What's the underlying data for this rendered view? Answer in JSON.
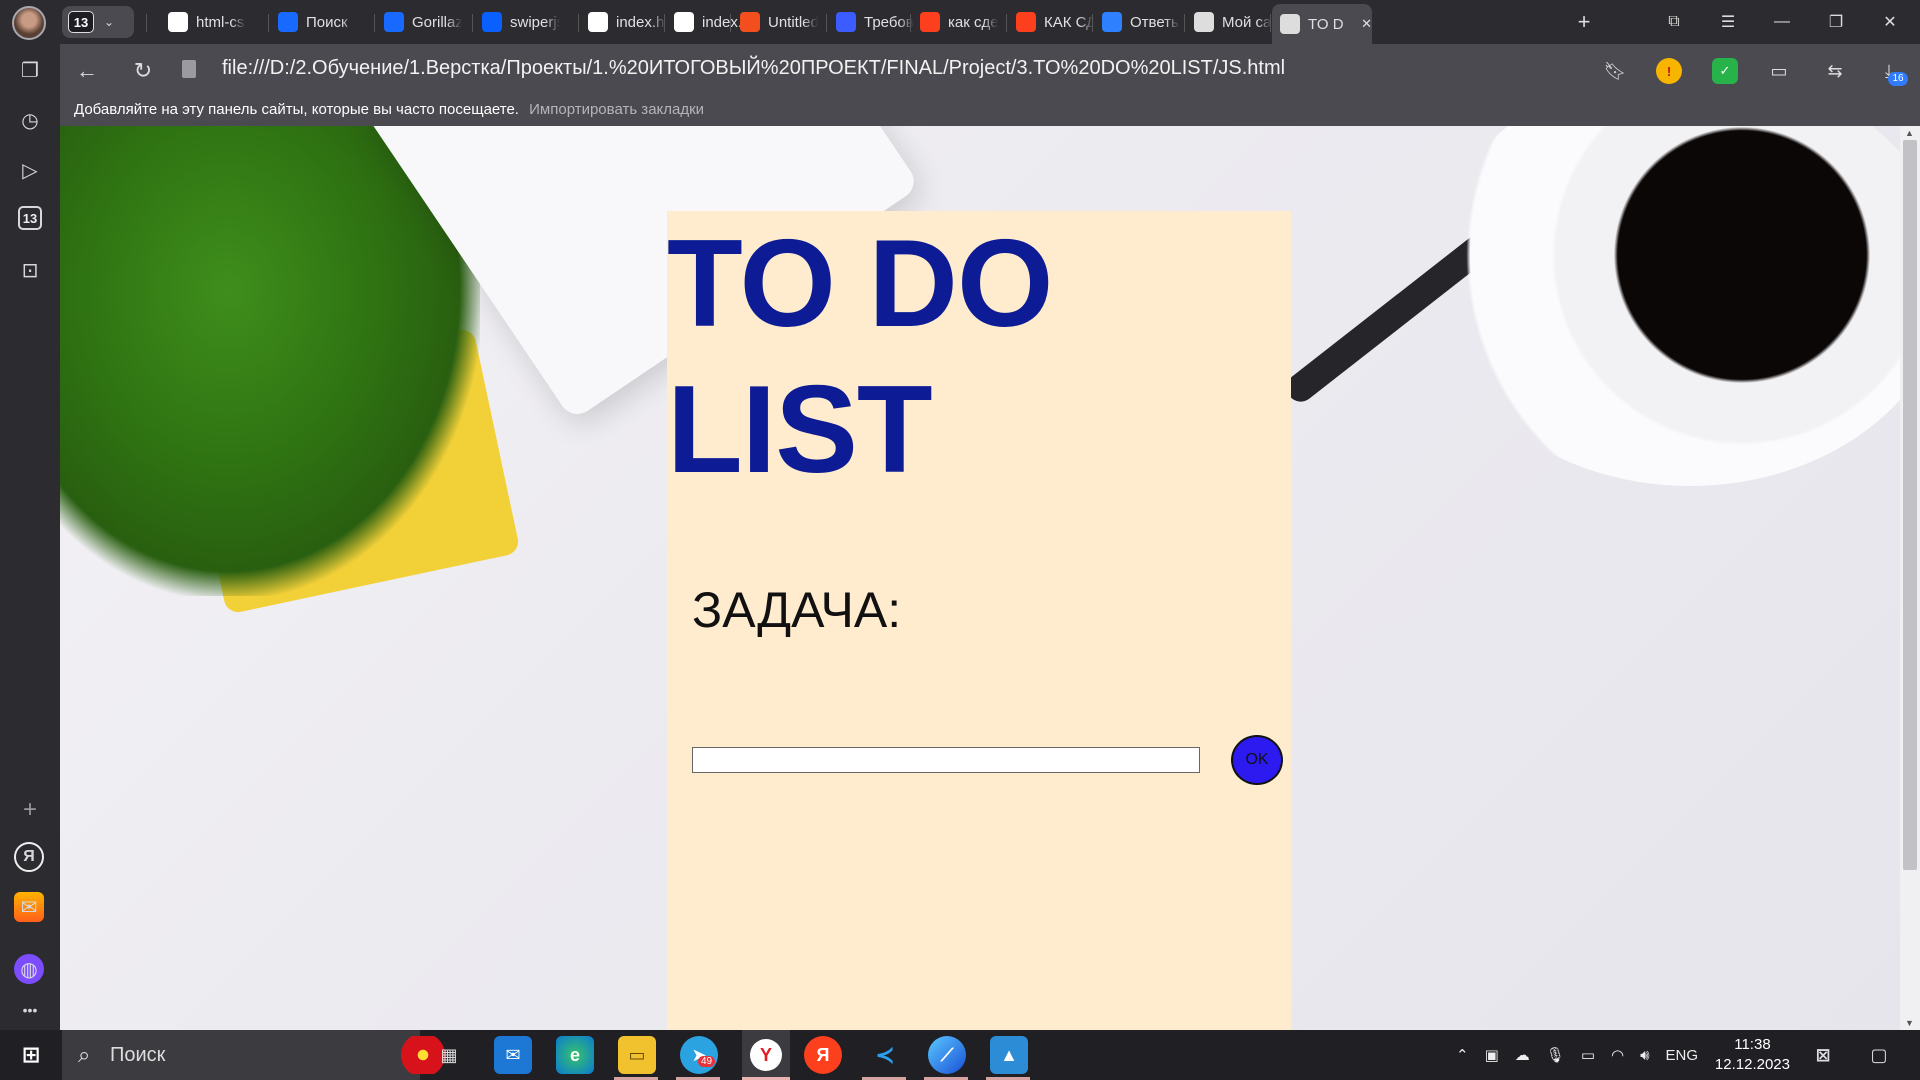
{
  "browser": {
    "tab_count": "13",
    "tabs": [
      {
        "label": "html-cs",
        "icon": "github-icon",
        "color": "#ffffff"
      },
      {
        "label": "Поиск",
        "icon": "behance-icon",
        "color": "#1769ff"
      },
      {
        "label": "Gorillaz",
        "icon": "behance-icon",
        "color": "#1769ff"
      },
      {
        "label": "swiperjs",
        "icon": "swiper-icon",
        "color": "#0a60ff"
      },
      {
        "label": "index.ht",
        "icon": "codepen-icon",
        "color": "#ffffff"
      },
      {
        "label": "index.ht",
        "icon": "codepen-icon",
        "color": "#ffffff"
      },
      {
        "label": "Untitled",
        "icon": "figma-icon",
        "color": "#f24e1e"
      },
      {
        "label": "Требов",
        "icon": "skillbox-icon",
        "color": "#3d5cff"
      },
      {
        "label": "как сде",
        "icon": "yandex-icon",
        "color": "#fc3f1d"
      },
      {
        "label": "КАК СД",
        "icon": "yandex-icon",
        "color": "#fc3f1d"
      },
      {
        "label": "Ответы",
        "icon": "answers-icon",
        "color": "#2f80ff"
      },
      {
        "label": "Мой са",
        "icon": "document-icon",
        "color": "#dddddd"
      },
      {
        "label": "TO D",
        "icon": "page-icon",
        "color": "#dddddd"
      }
    ],
    "url": "file:///D:/2.Обучение/1.Верстка/Проекты/1.%20ИТОГОВЫЙ%20ПРОЕКТ/FINAL/Project/3.TO%20DO%20LIST/JS.html",
    "bookmarks_hint": "Добавляйте на эту панель сайты, которые вы часто посещаете.",
    "import_bookmarks": "Импортировать закладки",
    "sidebar_badge": "13",
    "downloads_badge": "16"
  },
  "page": {
    "title": "TO DO LIST",
    "task_label": "ЗАДАЧА:",
    "task_input_value": "",
    "ok_label": "OK",
    "card_color": "#ffecce",
    "title_color": "#0d1c94",
    "ok_color": "#2c1af0"
  },
  "taskbar": {
    "search_placeholder": "Поиск",
    "telegram_badge": "49",
    "lang": "ENG",
    "time": "11:38",
    "date": "12.12.2023"
  }
}
